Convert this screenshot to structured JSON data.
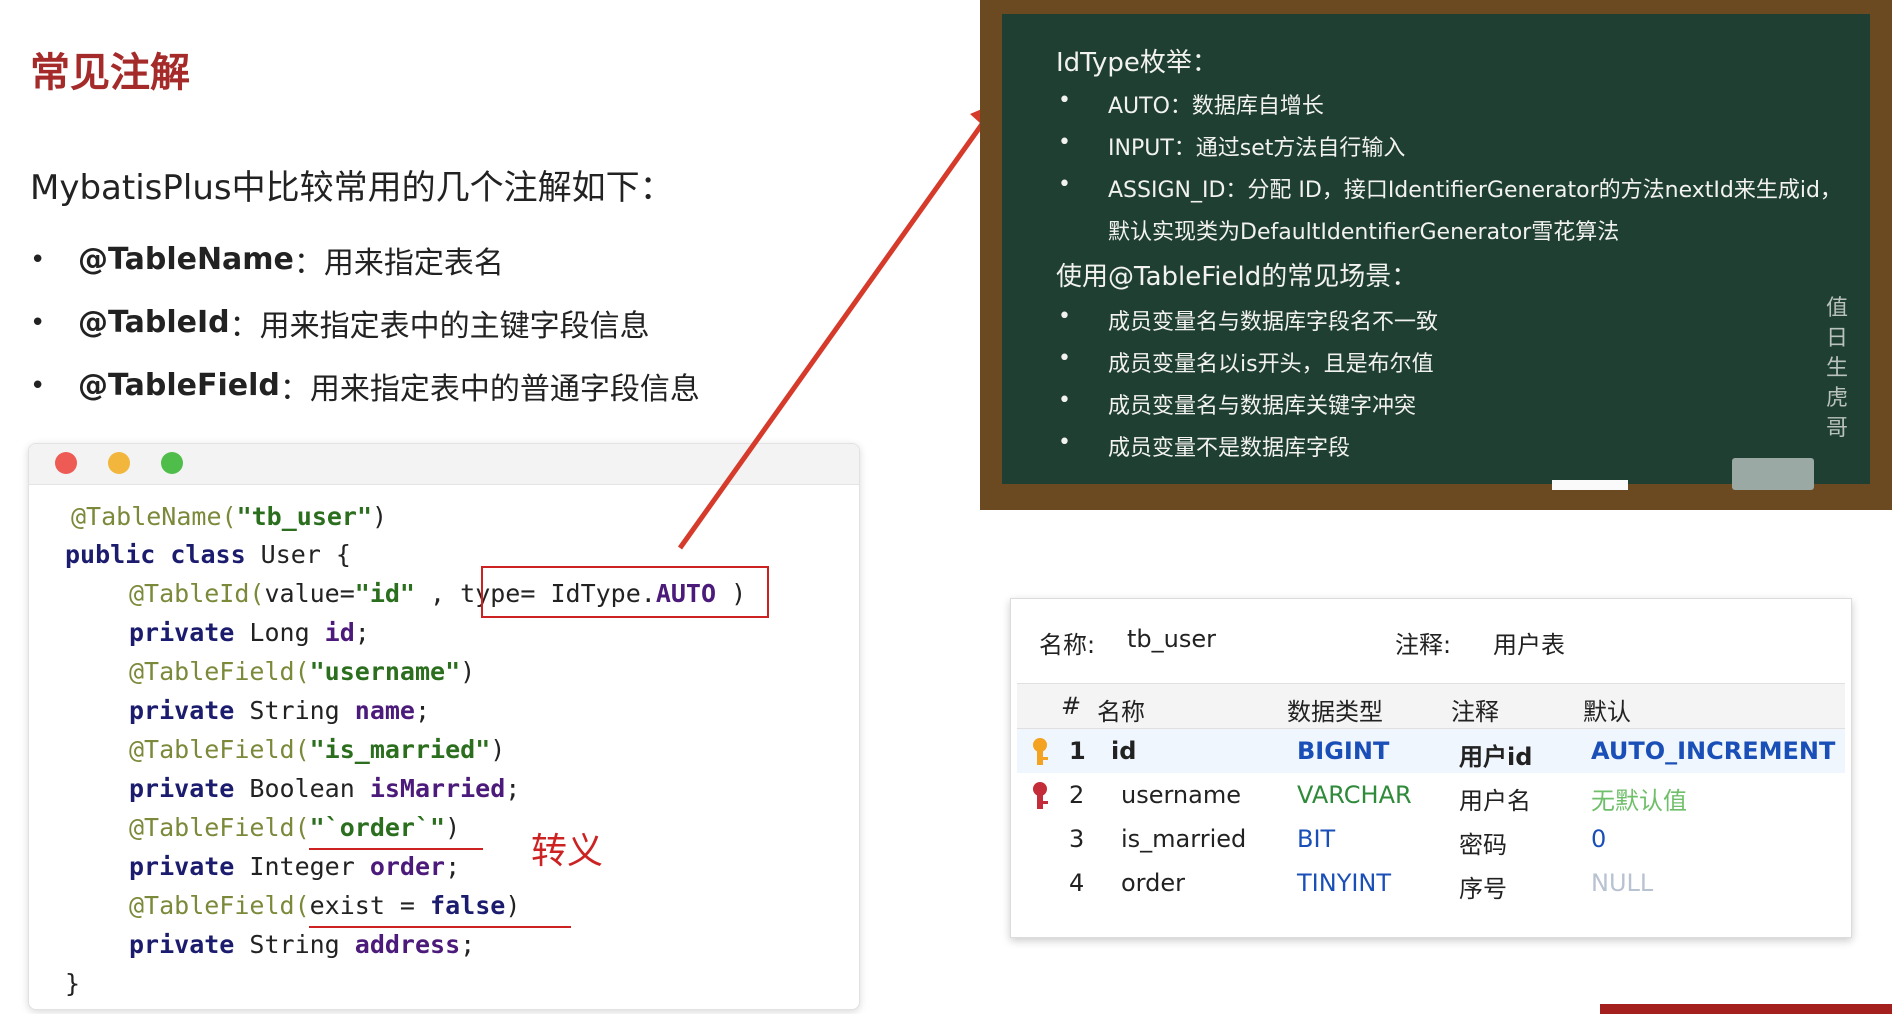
{
  "slide": {
    "title": "常见注解",
    "intro": "MybatisPlus中比较常用的几个注解如下：",
    "bullets": [
      {
        "name": "@TableName",
        "desc": "：用来指定表名"
      },
      {
        "name": "@TableId",
        "desc": "：用来指定表中的主键字段信息"
      },
      {
        "name": "@TableField",
        "desc": "：用来指定表中的普通字段信息"
      }
    ],
    "bullet_glyph": "•"
  },
  "code": {
    "l1_ann": "@TableName(",
    "l1_str": "\"tb_user\"",
    "l1_end": ")",
    "l2_kw": "public class",
    "l2_rest": " User {",
    "l3_ann": "@TableId(",
    "l3_a": "value=",
    "l3_str": "\"id\"",
    "l3_comma": " , ",
    "l3_type": "type= IdType.",
    "l3_auto": "AUTO",
    "l3_end": " )",
    "l4_kw": "private",
    "l4_type": " Long ",
    "l4_fld": "id",
    "l4_end": ";",
    "l5_ann": "@TableField(",
    "l5_str": "\"username\"",
    "l5_end": ")",
    "l6_kw": "private",
    "l6_type": " String ",
    "l6_fld": "name",
    "l6_end": ";",
    "l7_ann": "@TableField(",
    "l7_str": "\"is_married\"",
    "l7_end": ")",
    "l8_kw": "private",
    "l8_type": " Boolean ",
    "l8_fld": "isMarried",
    "l8_end": ";",
    "l9_ann": "@TableField(",
    "l9_str": "\"`order`\"",
    "l9_end": ")",
    "l10_kw": "private",
    "l10_type": " Integer ",
    "l10_fld": "order",
    "l10_end": ";",
    "l11_ann": "@TableField(",
    "l11_a": "exist = ",
    "l11_kw": "false",
    "l11_end": ")",
    "l12_kw": "private",
    "l12_type": " String ",
    "l12_fld": "address",
    "l12_end": ";",
    "l13": "}",
    "escape_note": "转义"
  },
  "board": {
    "h1": "IdType枚举：",
    "items1": [
      "AUTO：数据库自增长",
      "INPUT：通过set方法自行输入",
      "ASSIGN_ID：分配 ID，接口IdentifierGenerator的方法nextId来生成id，",
      "默认实现类为DefaultIdentifierGenerator雪花算法"
    ],
    "h2": "使用@TableField的常见场景：",
    "items2": [
      "成员变量名与数据库字段名不一致",
      "成员变量名以is开头，且是布尔值",
      "成员变量名与数据库关键字冲突",
      "成员变量不是数据库字段"
    ],
    "signature": [
      "值",
      "日",
      "生",
      "虎",
      "哥"
    ],
    "bullet_glyph": "•"
  },
  "table": {
    "name_label": "名称:",
    "name_value": "tb_user",
    "comment_label": "注释:",
    "comment_value": "用户表",
    "headers": [
      "#",
      "名称",
      "数据类型",
      "注释",
      "默认"
    ],
    "rows": [
      {
        "num": "1",
        "name": "id",
        "type": "BIGINT",
        "comment": "用户id",
        "default": "AUTO_INCREMENT"
      },
      {
        "num": "2",
        "name": "username",
        "type": "VARCHAR",
        "comment": "用户名",
        "default": "无默认值"
      },
      {
        "num": "3",
        "name": "is_married",
        "type": "BIT",
        "comment": "密码",
        "default": "0"
      },
      {
        "num": "4",
        "name": "order",
        "type": "TINYINT",
        "comment": "序号",
        "default": "NULL"
      }
    ]
  },
  "colors": {
    "title": "#a52a2a",
    "annotation": "#cc2222",
    "board": "#1f3f33",
    "frame": "#6b4a22"
  }
}
